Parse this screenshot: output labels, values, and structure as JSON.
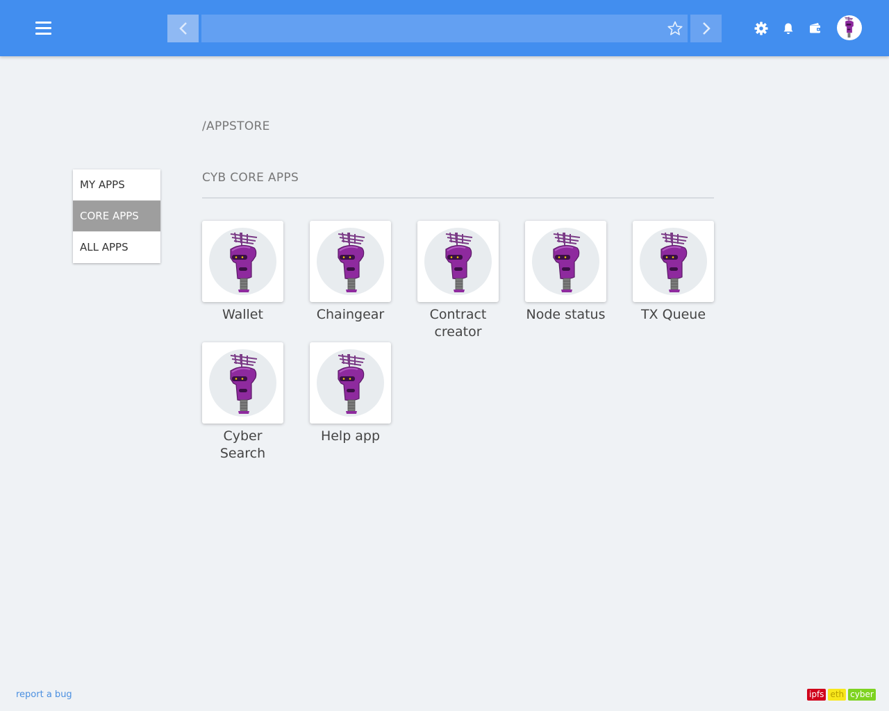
{
  "topbar": {
    "menu_icon": "hamburger-icon",
    "back_icon": "chevron-left-icon",
    "forward_icon": "chevron-right-icon",
    "address_value": "",
    "favorite_icon": "star-outline-icon",
    "settings_icon": "gear-icon",
    "notifications_icon": "bell-icon",
    "wallet_icon": "wallet-icon",
    "avatar_icon": "robot-avatar"
  },
  "page_title": "/APPSTORE",
  "sidebar": {
    "items": [
      {
        "label": "MY APPS",
        "active": false
      },
      {
        "label": "CORE APPS",
        "active": true
      },
      {
        "label": "ALL APPS",
        "active": false
      }
    ]
  },
  "section": {
    "title": "CYB CORE APPS",
    "apps": [
      {
        "name": "Wallet",
        "icon": "robot-icon"
      },
      {
        "name": "Chaingear",
        "icon": "robot-icon"
      },
      {
        "name": "Contract creator",
        "icon": "robot-icon"
      },
      {
        "name": "Node status",
        "icon": "robot-icon"
      },
      {
        "name": "TX Queue",
        "icon": "robot-icon"
      },
      {
        "name": "Cyber Search",
        "icon": "robot-icon"
      },
      {
        "name": "Help app",
        "icon": "robot-icon"
      }
    ]
  },
  "footer": {
    "report_link": "report a bug",
    "badges": [
      {
        "label": "ipfs",
        "color": "#d0021b"
      },
      {
        "label": "eth",
        "color": "#f8e71c"
      },
      {
        "label": "cyber",
        "color": "#7ed321"
      }
    ]
  },
  "colors": {
    "topbar": "#428eef",
    "background": "#eff2f5",
    "active_menu": "#9e9e9e",
    "robot_purple": "#8e2a9e"
  }
}
